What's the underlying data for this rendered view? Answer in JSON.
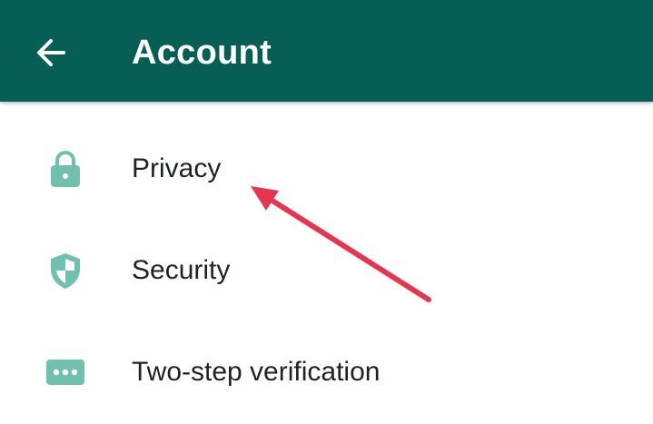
{
  "header": {
    "title": "Account",
    "back_icon": "arrow-left-icon",
    "background_color": "#075e54"
  },
  "items": [
    {
      "label": "Privacy",
      "icon": "lock-icon"
    },
    {
      "label": "Security",
      "icon": "shield-icon"
    },
    {
      "label": "Two-step verification",
      "icon": "dots-icon"
    }
  ],
  "colors": {
    "icon": "#71bfae",
    "text": "#1f2124",
    "annotation_arrow": "#e6364f"
  },
  "annotation": {
    "type": "arrow",
    "points_to": "Privacy"
  }
}
